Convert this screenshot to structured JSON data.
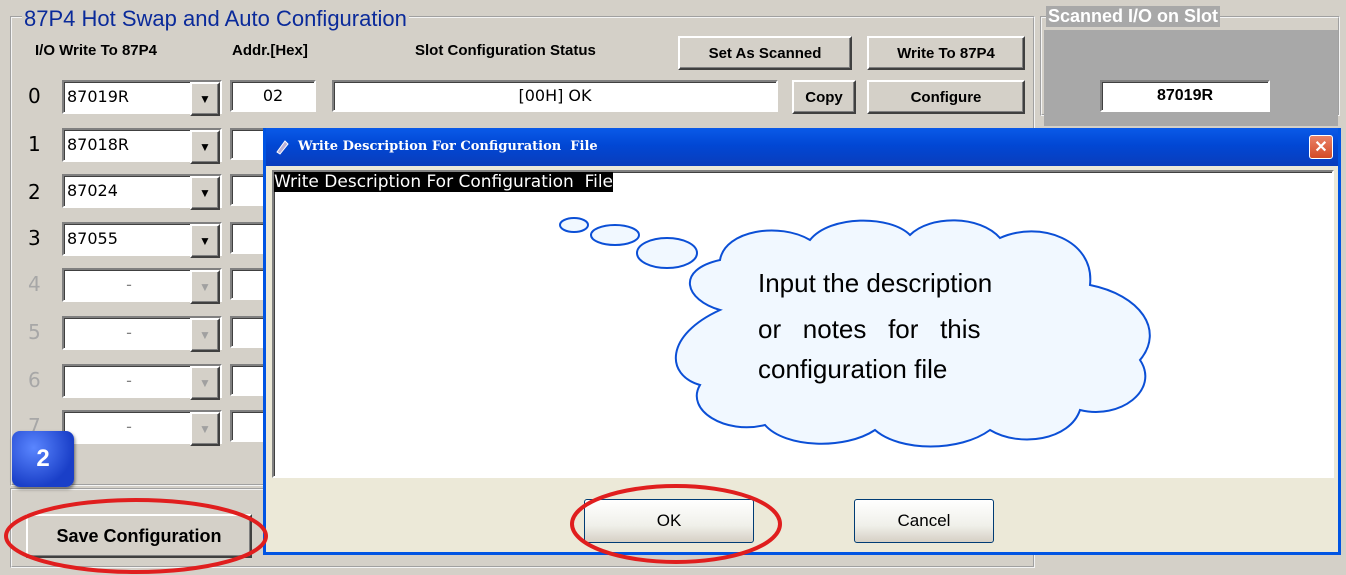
{
  "main_panel": {
    "title": "87P4 Hot Swap and Auto Configuration",
    "headers": {
      "io_write": "I/O Write To 87P4",
      "addr": "Addr.[Hex]",
      "status": "Slot Configuration Status"
    },
    "set_as_scanned_label": "Set As Scanned",
    "write_to_label": "Write To 87P4",
    "copy_label": "Copy",
    "configure_label": "Configure",
    "save_label": "Save Configuration"
  },
  "slots": [
    {
      "num": "0",
      "module": "87019R",
      "addr": "02",
      "status": "[00H] OK"
    },
    {
      "num": "1",
      "module": "87018R"
    },
    {
      "num": "2",
      "module": "87024"
    },
    {
      "num": "3",
      "module": "87055"
    },
    {
      "num": "4",
      "module": "-"
    },
    {
      "num": "5",
      "module": "-"
    },
    {
      "num": "6",
      "module": "-"
    },
    {
      "num": "7",
      "module": "-"
    }
  ],
  "scanned_panel": {
    "title": "Scanned I/O on Slot",
    "value": "87019R"
  },
  "dialog": {
    "title": "Write Description For Configuration  File",
    "text": "Write Description For Configuration  File",
    "ok_label": "OK",
    "cancel_label": "Cancel"
  },
  "annotations": {
    "step_badge": "2",
    "callout_line1": "Input the description",
    "callout_line2": "or   notes   for   this",
    "callout_line3": "configuration file",
    "highlight_color": "#e01e1e",
    "badge_color": "#1a3fc8"
  }
}
